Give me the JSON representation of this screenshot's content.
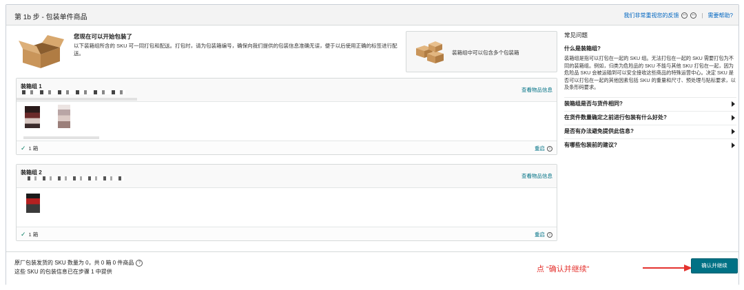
{
  "header": {
    "title": "第 1b 步 - 包装单件商品",
    "feedback": "我们非常重视您的反馈",
    "help": "需要帮助?"
  },
  "intro": {
    "title": "您现在可以开始包装了",
    "text": "以下装箱组所含的 SKU 可一同打包和配送。打包时，请为包装箱编号，确保向我们提供的包装信息准确无误，便于以后使用正确的标签进行配送。"
  },
  "hint": {
    "text": "装箱组中可以包含多个包装箱"
  },
  "groups": [
    {
      "title": "装箱组 1",
      "link": "查看物品信息",
      "count": "1 箱",
      "reset": "重启"
    },
    {
      "title": "装箱组 2",
      "link": "查看物品信息",
      "count": "1 箱",
      "reset": "重启"
    }
  ],
  "faq": {
    "heading": "常见问题",
    "open_question": "什么是装箱组?",
    "open_answer": "装箱组是指可以打包在一起的 SKU 组。无法打包在一起的 SKU 需要打包为不同的装箱组。例如，归类为危险品的 SKU 不能与其他 SKU 打包在一起，因为危险品 SKU 会被运输到可以安全接收这些商品的特殊运营中心。决定 SKU 是否可以打包在一起的其他因素包括 SKU 的重量和尺寸、预处理与贴标要求，以及条形码要求。",
    "questions": [
      "装箱组是否与货件相同?",
      "在货件数量确定之前进行包装有什么好处?",
      "是否有办法避免提供此信息?",
      "有哪些包装前的建议?"
    ]
  },
  "footer": {
    "line1": "原厂包装发货的 SKU 数量为 0，共 0 箱 0 件商品",
    "line2": "这些 SKU 的包装信息已在步骤 1 中提供",
    "annotation": "点 “确认并继续”",
    "confirm_button": "确认并继续"
  },
  "colors": {
    "accent": "#007185",
    "annotation": "#e4322e",
    "success": "#067d62"
  }
}
